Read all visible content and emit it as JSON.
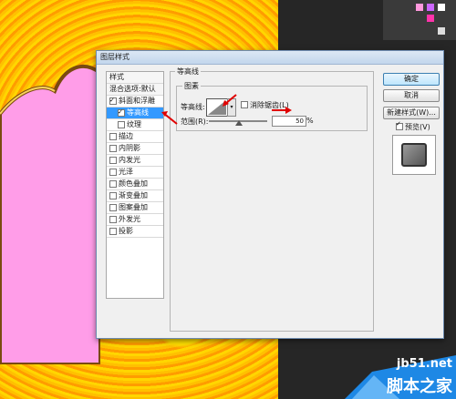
{
  "dialog": {
    "title": "图层样式",
    "styles_header": "样式",
    "blend_options": "混合选项:默认",
    "styles": [
      {
        "label": "斜面和浮雕",
        "checked": true,
        "selected": false,
        "sub": false
      },
      {
        "label": "等高线",
        "checked": true,
        "selected": true,
        "sub": true
      },
      {
        "label": "纹理",
        "checked": false,
        "selected": false,
        "sub": true
      },
      {
        "label": "描边",
        "checked": false,
        "selected": false,
        "sub": false
      },
      {
        "label": "内阴影",
        "checked": false,
        "selected": false,
        "sub": false
      },
      {
        "label": "内发光",
        "checked": false,
        "selected": false,
        "sub": false
      },
      {
        "label": "光泽",
        "checked": false,
        "selected": false,
        "sub": false
      },
      {
        "label": "颜色叠加",
        "checked": false,
        "selected": false,
        "sub": false
      },
      {
        "label": "渐变叠加",
        "checked": false,
        "selected": false,
        "sub": false
      },
      {
        "label": "图案叠加",
        "checked": false,
        "selected": false,
        "sub": false
      },
      {
        "label": "外发光",
        "checked": false,
        "selected": false,
        "sub": false
      },
      {
        "label": "投影",
        "checked": false,
        "selected": false,
        "sub": false
      }
    ],
    "group_title": "等高线",
    "subgroup_title": "图素",
    "contour_label": "等高线:",
    "anti_alias_label": "消除锯齿(L)",
    "anti_alias_checked": false,
    "range_label": "范围(R):",
    "range_value": "50",
    "range_unit": "%",
    "buttons": {
      "ok": "确定",
      "cancel": "取消",
      "new_style": "新建样式(W)..."
    },
    "preview_label": "预览(V)",
    "preview_checked": true
  },
  "watermark": {
    "url": "jb51.net",
    "name": "脚本之家"
  },
  "colors": {
    "accent": "#3399ff",
    "arrow": "#e00000"
  }
}
